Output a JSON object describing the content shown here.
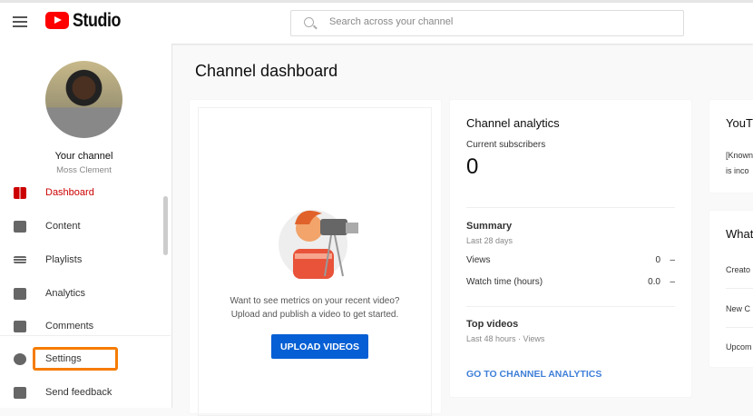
{
  "header": {
    "app_name": "Studio",
    "search_placeholder": "Search across your channel"
  },
  "sidebar": {
    "channel_label": "Your channel",
    "channel_name": "Moss Clement",
    "items": [
      {
        "label": "Dashboard"
      },
      {
        "label": "Content"
      },
      {
        "label": "Playlists"
      },
      {
        "label": "Analytics"
      },
      {
        "label": "Comments"
      },
      {
        "label": "Settings"
      },
      {
        "label": "Send feedback"
      }
    ]
  },
  "main": {
    "title": "Channel dashboard",
    "upload_card": {
      "line1": "Want to see metrics on your recent video?",
      "line2": "Upload and publish a video to get started.",
      "button": "UPLOAD VIDEOS"
    },
    "analytics": {
      "title": "Channel analytics",
      "subs_label": "Current subscribers",
      "subs_value": "0",
      "summary": "Summary",
      "summary_period": "Last 28 days",
      "rows": [
        {
          "label": "Views",
          "value": "0",
          "trend": "–"
        },
        {
          "label": "Watch time (hours)",
          "value": "0.0",
          "trend": "–"
        }
      ],
      "top_videos": "Top videos",
      "top_period": "Last 48 hours · Views",
      "link": "GO TO CHANNEL ANALYTICS"
    },
    "news_card": {
      "title": "YouT",
      "text1": "[Known",
      "text2": "is inco"
    },
    "whats_new": {
      "title": "What",
      "items": [
        "Creato",
        "New C",
        "Upcom"
      ]
    }
  },
  "colors": {
    "accent": "#065fd4",
    "active": "#cc0000",
    "highlight": "#f57c00"
  }
}
